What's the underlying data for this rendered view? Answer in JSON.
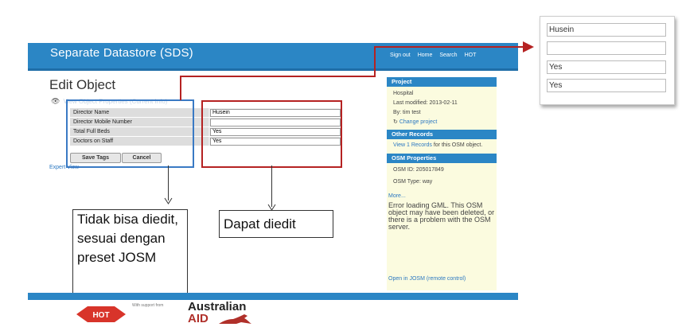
{
  "header": {
    "title": "Separate Datastore (SDS)",
    "nav": [
      "Sign out",
      "Home",
      "Search",
      "HOT"
    ]
  },
  "edit": {
    "title": "Edit Object",
    "view_link": "View Object Properties (Current Info)",
    "rows": [
      {
        "key": "Director Name",
        "value": "Husein"
      },
      {
        "key": "Director Mobile Number",
        "value": ""
      },
      {
        "key": "Total Full Beds",
        "value": "Yes"
      },
      {
        "key": "Doctors on Staff",
        "value": "Yes"
      }
    ],
    "save_label": "Save Tags",
    "cancel_label": "Cancel",
    "expert_view": "Expert View"
  },
  "annotations": {
    "not_editable": "Tidak bisa diedit, sesuai dengan preset JOSM",
    "editable": "Dapat diedit"
  },
  "sidebar": {
    "project_title": "Project",
    "project_name": "Hospital",
    "last_modified": "Last modified: 2013-02-11",
    "by": "By: tim test",
    "change_project": "Change project",
    "other_title": "Other Records",
    "view_records_link": "View 1 Records",
    "view_records_rest": " for this OSM object.",
    "osm_title": "OSM Properties",
    "osm_id": "OSM ID: 205017849",
    "osm_type": "OSM Type: way",
    "more": "More...",
    "error": "Error loading GML. This OSM object may have been deleted, or there is a problem with the OSM server.",
    "josm": "Open in JOSM (remote control)"
  },
  "footer": {
    "support_text": "With support from",
    "hot_logo": "HOT",
    "aid_logo_line1": "Australian",
    "aid_logo_line2": "AID"
  },
  "zoom": {
    "values": [
      "Husein",
      "",
      "Yes",
      "Yes"
    ]
  },
  "colors": {
    "header_blue": "#2b86c5",
    "annotation_red": "#b52222",
    "annotation_blue": "#3a7ac4",
    "sidebar_bg": "#fbfbdf"
  }
}
